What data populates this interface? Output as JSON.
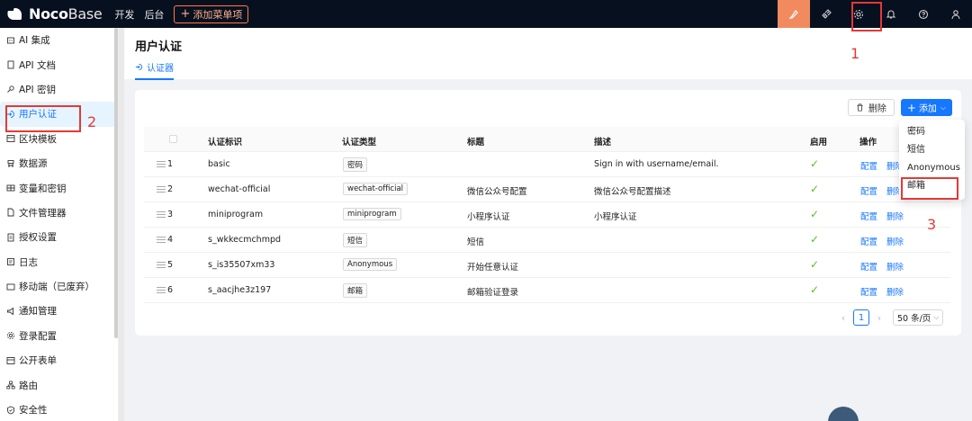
{
  "topbar": {
    "logo_bold": "Noco",
    "logo_light": "Base",
    "nav": [
      "开发",
      "后台"
    ],
    "add_menu": "添加菜单项",
    "icons": [
      "highlighter-icon",
      "plugin-icon",
      "gear-icon",
      "bell-icon",
      "help-icon",
      "user-icon"
    ],
    "accent": "#f18b5f"
  },
  "sidebar": {
    "items": [
      {
        "label": "AI 集成",
        "icon": "robot-icon"
      },
      {
        "label": "API 文档",
        "icon": "book-icon"
      },
      {
        "label": "API 密钥",
        "icon": "key-icon"
      },
      {
        "label": "用户认证",
        "icon": "login-icon",
        "active": true
      },
      {
        "label": "区块模板",
        "icon": "layout-icon"
      },
      {
        "label": "数据源",
        "icon": "database-icon"
      },
      {
        "label": "变量和密钥",
        "icon": "table-icon"
      },
      {
        "label": "文件管理器",
        "icon": "file-icon"
      },
      {
        "label": "授权设置",
        "icon": "license-icon"
      },
      {
        "label": "日志",
        "icon": "log-icon"
      },
      {
        "label": "移动端（已废弃）",
        "icon": "mobile-icon"
      },
      {
        "label": "通知管理",
        "icon": "notification-icon"
      },
      {
        "label": "登录配置",
        "icon": "settings-icon"
      },
      {
        "label": "公开表单",
        "icon": "form-icon"
      },
      {
        "label": "路由",
        "icon": "route-icon"
      },
      {
        "label": "安全性",
        "icon": "shield-icon"
      }
    ]
  },
  "page": {
    "title": "用户认证",
    "tab": "认证器"
  },
  "toolbar": {
    "delete_label": "删除",
    "add_label": "添加"
  },
  "table": {
    "columns": [
      "认证标识",
      "认证类型",
      "标题",
      "描述",
      "启用",
      "操作"
    ],
    "rows": [
      {
        "index": "1",
        "name": "basic",
        "type": "密码",
        "title": "",
        "description": "Sign in with username/email.",
        "enabled": true
      },
      {
        "index": "2",
        "name": "wechat-official",
        "type": "wechat-official",
        "title": "微信公众号配置",
        "description": "微信公众号配置描述",
        "enabled": true
      },
      {
        "index": "3",
        "name": "miniprogram",
        "type": "miniprogram",
        "title": "小程序认证",
        "description": "小程序认证",
        "enabled": true
      },
      {
        "index": "4",
        "name": "s_wkkecmchmpd",
        "type": "短信",
        "title": "短信",
        "description": "",
        "enabled": true
      },
      {
        "index": "5",
        "name": "s_is35507xm33",
        "type": "Anonymous",
        "title": "开始任意认证",
        "description": "",
        "enabled": true
      },
      {
        "index": "6",
        "name": "s_aacjhe3z197",
        "type": "邮箱",
        "title": "邮箱验证登录",
        "description": "",
        "enabled": true
      }
    ],
    "action_config": "配置",
    "action_delete": "删除"
  },
  "pagination": {
    "current": "1",
    "page_size": "50 条/页"
  },
  "dropdown": {
    "items": [
      "密码",
      "短信",
      "Anonymous",
      "邮箱"
    ]
  },
  "annotations": {
    "step1": "1",
    "step2": "2",
    "step3": "3",
    "color": "#e53935"
  }
}
